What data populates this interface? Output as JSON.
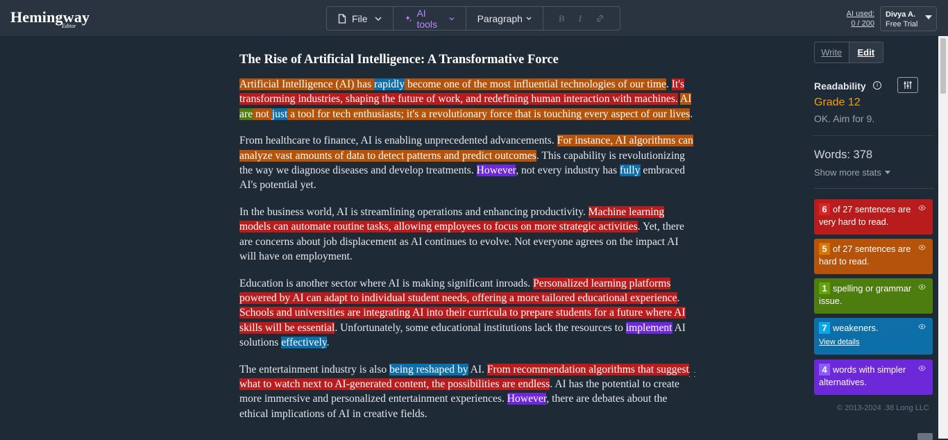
{
  "app": {
    "logo": "Hemingway",
    "logo_sub": "Editor"
  },
  "toolbar": {
    "file": "File",
    "ai_tools": "AI tools",
    "paragraph": "Paragraph",
    "bold": "B",
    "italic": "I"
  },
  "header": {
    "ai_used_label": "AI used:",
    "ai_used_value": "0 / 200",
    "user_name": "Divya A.",
    "user_plan": "Free Trial"
  },
  "document": {
    "title": "The Rise of Artificial Intelligence: A Transformative Force",
    "paragraphs": [
      [
        {
          "t": "Artificial Intelligence (AI) has ",
          "h": "med"
        },
        {
          "t": "rapidly",
          "h": "adv"
        },
        {
          "t": " become one of the most influential technologies of our time",
          "h": "med"
        },
        {
          "t": ". "
        },
        {
          "t": "It's transforming industries, shaping the future of work, and redefining human interaction with machines.",
          "h": "hard"
        },
        {
          "t": " "
        },
        {
          "t": "AI ",
          "h": "med"
        },
        {
          "t": "are",
          "h": "gram"
        },
        {
          "t": " not ",
          "h": "med"
        },
        {
          "t": "just",
          "h": "adv"
        },
        {
          "t": " a tool for tech enthusiasts; it's a revolutionary force that is touching every aspect of our lives",
          "h": "med"
        },
        {
          "t": "."
        }
      ],
      [
        {
          "t": "From healthcare to finance, AI is enabling unprecedented advancements. "
        },
        {
          "t": "For instance, AI algorithms can analyze vast amounts of data to detect patterns and predict outcomes",
          "h": "med"
        },
        {
          "t": ". This capability is revolutionizing the way we diagnose diseases and develop treatments. "
        },
        {
          "t": "However",
          "h": "simp"
        },
        {
          "t": ", not every industry has "
        },
        {
          "t": "fully",
          "h": "adv"
        },
        {
          "t": " embraced AI's potential yet."
        }
      ],
      [
        {
          "t": "In the business world, AI is streamlining operations and enhancing productivity. "
        },
        {
          "t": "Machine learning models can automate routine tasks, allowing employees to focus on more strategic activities",
          "h": "hard"
        },
        {
          "t": ". Yet, there are concerns about job displacement as AI continues to evolve. Not everyone agrees on the impact AI will have on employment."
        }
      ],
      [
        {
          "t": "Education is another sector where AI is making significant inroads. "
        },
        {
          "t": "Personalized learning platforms powered by AI can adapt to individual student needs, offering a more tailored educational experience",
          "h": "hard"
        },
        {
          "t": ". "
        },
        {
          "t": "Schools and universities are integrating AI into their curricula to prepare students for a future where AI skills will be essential",
          "h": "hard"
        },
        {
          "t": ". Unfortunately, some educational institutions lack the resources to "
        },
        {
          "t": "implement",
          "h": "simp"
        },
        {
          "t": " AI solutions "
        },
        {
          "t": "effectively",
          "h": "adv"
        },
        {
          "t": "."
        }
      ],
      [
        {
          "t": "The entertainment industry is also "
        },
        {
          "t": "being reshaped by",
          "h": "pas"
        },
        {
          "t": " AI. "
        },
        {
          "t": "From recommendation algorithms that suggest what to watch next to AI-generated content, the possibilities are endless",
          "h": "hard"
        },
        {
          "t": ". AI has the potential to create more immersive and personalized entertainment experiences. "
        },
        {
          "t": "However",
          "h": "simp"
        },
        {
          "t": ", there are debates about the ethical implications of AI in creative fields."
        }
      ]
    ]
  },
  "sidebar": {
    "tab_write": "Write",
    "tab_edit": "Edit",
    "readability_label": "Readability",
    "grade": "Grade 12",
    "aim": "OK. Aim for 9.",
    "words": "Words: 378",
    "show_more": "Show more stats",
    "cards": [
      {
        "num": "6",
        "text": "of 27 sentences are very hard to read."
      },
      {
        "num": "5",
        "text": "of 27 sentences are hard to read."
      },
      {
        "num": "1",
        "text": "spelling or grammar issue."
      },
      {
        "num": "7",
        "text": "weakeners.",
        "link": "View details"
      },
      {
        "num": "4",
        "text": "words with simpler alternatives."
      }
    ],
    "copyright": "© 2013-2024 .38 Long LLC"
  },
  "colors": {
    "very_hard": "#b91c1c",
    "hard": "#b45309",
    "grammar": "#4d7c0f",
    "weakener": "#0e6ea8",
    "simpler": "#6d28d9",
    "grade": "#f59e0b"
  }
}
